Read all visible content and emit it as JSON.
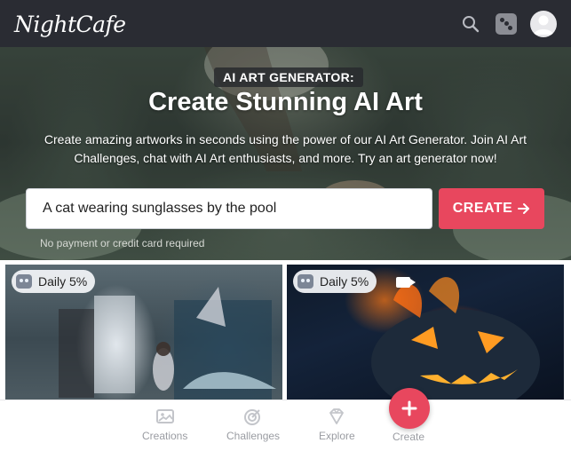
{
  "header": {
    "logo_text": "NightCafe",
    "search_icon": "search-icon",
    "dice_icon": "dice-icon",
    "avatar_icon": "user-avatar"
  },
  "hero": {
    "badge": "AI ART GENERATOR:",
    "title": "Create Stunning AI Art",
    "subtitle": "Create amazing artworks in seconds using the power of our AI Art Generator. Join AI Art Challenges, chat with AI Art enthusiasts, and more. Try an art generator now!",
    "prompt_value": "A cat wearing sunglasses by the pool",
    "create_label": "CREATE",
    "create_icon": "arrow-right-icon",
    "note": "No payment or credit card required"
  },
  "cards": [
    {
      "badge": "Daily 5%",
      "icon": "robot-icon"
    },
    {
      "badge": "Daily 5%",
      "icon": "robot-icon",
      "extra_icon": "video-icon"
    }
  ],
  "bottom_nav": {
    "items": [
      {
        "label": "Creations",
        "icon": "image-icon"
      },
      {
        "label": "Challenges",
        "icon": "target-icon"
      },
      {
        "label": "Explore",
        "icon": "diamond-icon"
      },
      {
        "label": "Create",
        "icon": "plus-icon"
      }
    ]
  },
  "colors": {
    "header_bg": "#2a2c33",
    "accent": "#e8475e",
    "nav_text": "#9a9ca2"
  }
}
